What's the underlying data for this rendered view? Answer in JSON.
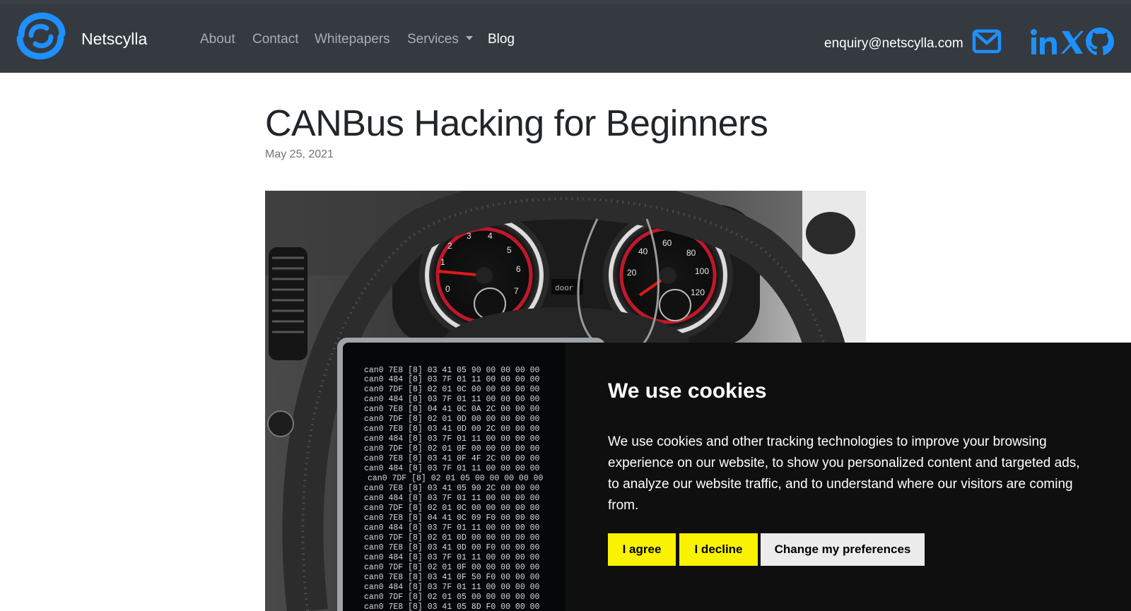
{
  "navbar": {
    "brand": "Netscylla",
    "links": [
      {
        "label": "About"
      },
      {
        "label": "Contact"
      },
      {
        "label": "Whitepapers"
      },
      {
        "label": "Services",
        "has_dropdown": true
      },
      {
        "label": "Blog",
        "active": true
      }
    ],
    "email": "enquiry@netscylla.com",
    "icons": [
      "mail-icon",
      "linkedin-icon",
      "x-icon",
      "github-icon"
    ]
  },
  "article": {
    "title": "CANBus Hacking for Beginners",
    "date": "May 25, 2021"
  },
  "hero": {
    "gauge_left_labels": [
      "1",
      "2",
      "3",
      "4",
      "5",
      "6",
      "7",
      "0"
    ],
    "gauge_right_labels": [
      "20",
      "40",
      "60",
      "80",
      "100",
      "120"
    ],
    "door_text": "door",
    "terminal_lines": [
      "can0  7E8   [8]  03 41 05 90 00 00 00 00",
      "can0  484   [8]  03 7F 01 11 00 00 00 00",
      "can0  7DF   [8]  02 01 0C 00 00 00 00 00",
      "can0  484   [8]  03 7F 01 11 00 00 00 00",
      "can0  7E8   [8]  04 41 0C 0A 2C 00 00 00",
      "can0  7DF   [8]  02 01 0D 00 00 00 00 00",
      "can0  7E8   [8]  03 41 0D 00 2C 00 00 00",
      "can0  484   [8]  03 7F 01 11 00 00 00 00",
      "can0  7DF   [8]  02 01 0F 00 00 00 00 00",
      "can0  7E8   [8]  03 41 0F 4F 2C 00 00 00",
      "can0  484   [8]  03 7F 01 11 00 00 00 00",
      "can0  7DF   [8]  02 01 05 00 00 00 00 00",
      "can0  7E8   [8]  03 41 05 90 2C 00 00 00",
      "can0  484   [8]  03 7F 01 11 00 00 00 00",
      "can0  7DF   [8]  02 01 0C 00 00 00 00 00",
      "can0  7E8   [8]  04 41 0C 09 F0 00 00 00",
      "can0  484   [8]  03 7F 01 11 00 00 00 00",
      "can0  7DF   [8]  02 01 0D 00 00 00 00 00",
      "can0  7E8   [8]  03 41 0D 00 F0 00 00 00",
      "can0  484   [8]  03 7F 01 11 00 00 00 00",
      "can0  7DF   [8]  02 01 0F 00 00 00 00 00",
      "can0  7E8   [8]  03 41 0F 50 F0 00 00 00",
      "can0  484   [8]  03 7F 01 11 00 00 00 00",
      "can0  7DF   [8]  02 01 05 00 00 00 00 00",
      "can0  7E8   [8]  03 41 05 8D F0 00 00 00"
    ]
  },
  "cookie_banner": {
    "title": "We use cookies",
    "text": "We use cookies and other tracking technologies to improve your browsing experience on our website, to show you personalized content and targeted ads, to analyze our website traffic, and to understand where our visitors are coming from.",
    "agree_label": "I agree",
    "decline_label": "I decline",
    "preferences_label": "Change my preferences"
  },
  "colors": {
    "navbar_bg": "#343a40",
    "accent_blue": "#1e90ff",
    "cookie_bg": "#0f0f10",
    "button_yellow": "#f9f200"
  }
}
